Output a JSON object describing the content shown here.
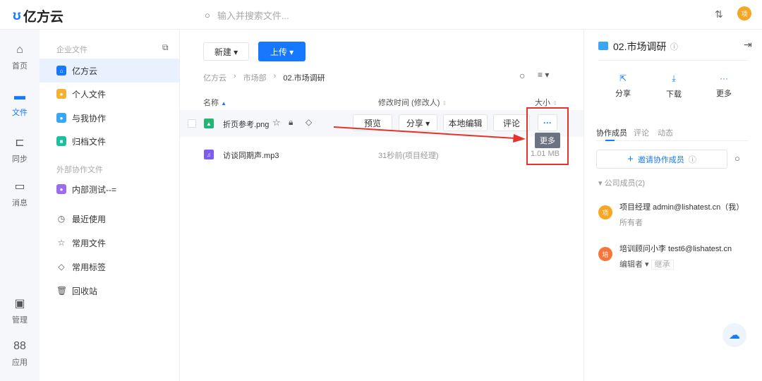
{
  "app": {
    "logo_text": "亿方云",
    "search_placeholder": "输入并搜索文件...",
    "user_avatar": "项"
  },
  "rail": [
    {
      "label": "首页",
      "icon": "home-icon"
    },
    {
      "label": "文件",
      "icon": "folder-icon"
    },
    {
      "label": "同步",
      "icon": "sync-folder-icon"
    },
    {
      "label": "消息",
      "icon": "message-icon"
    },
    {
      "label": "管理",
      "icon": "admin-icon"
    },
    {
      "label": "应用",
      "icon": "apps-icon"
    }
  ],
  "sidebar": {
    "enterprise_label": "企业文件",
    "external_label": "外部协作文件",
    "items": [
      {
        "label": "亿方云",
        "color": "#1677ff"
      },
      {
        "label": "个人文件",
        "color": "#f5b133"
      },
      {
        "label": "与我协作",
        "color": "#3aa7f5"
      },
      {
        "label": "归档文件",
        "color": "#18c2a0"
      },
      {
        "label": "内部测试--=",
        "color": "#9b6cf2"
      }
    ],
    "quick": [
      {
        "label": "最近使用",
        "icon": "clock-icon"
      },
      {
        "label": "常用文件",
        "icon": "star-icon"
      },
      {
        "label": "常用标签",
        "icon": "tag-icon"
      },
      {
        "label": "回收站",
        "icon": "trash-icon"
      }
    ]
  },
  "toolbar": {
    "new_label": "新建 ▾",
    "upload_label": "上传 ▾"
  },
  "breadcrumb": [
    "亿方云",
    "市场部",
    "02.市场调研"
  ],
  "table": {
    "headers": {
      "name": "名称",
      "modified": "修改时间 (修改人)",
      "size": "大小"
    },
    "rows": [
      {
        "name": "折页参考.png",
        "type": "image",
        "actions": [
          "预览",
          "分享 ▾",
          "本地编辑",
          "评论"
        ],
        "more": "···",
        "tooltip": "更多"
      },
      {
        "name": "访谈同期声.mp3",
        "type": "audio",
        "modified": "31秒前(项目经理)",
        "size": "1.01 MB"
      }
    ]
  },
  "panel": {
    "title": "02.市场调研",
    "actions": [
      {
        "label": "分享",
        "icon": "share-icon"
      },
      {
        "label": "下载",
        "icon": "download-icon"
      },
      {
        "label": "更多",
        "icon": "more-icon"
      }
    ],
    "tabs": [
      "协作成员",
      "评论",
      "动态"
    ],
    "invite_label": "邀请协作成员",
    "group_label": "公司成员(2)",
    "members": [
      {
        "avatar": "项",
        "name": "项目经理 admin@lishatest.cn（我）",
        "role": "所有者",
        "color": "#f5a623"
      },
      {
        "avatar": "培",
        "name": "培训顾问小李 test6@lishatest.cn",
        "role": "编辑者 ▾",
        "badge": "继承",
        "color": "#f5753a"
      }
    ]
  }
}
